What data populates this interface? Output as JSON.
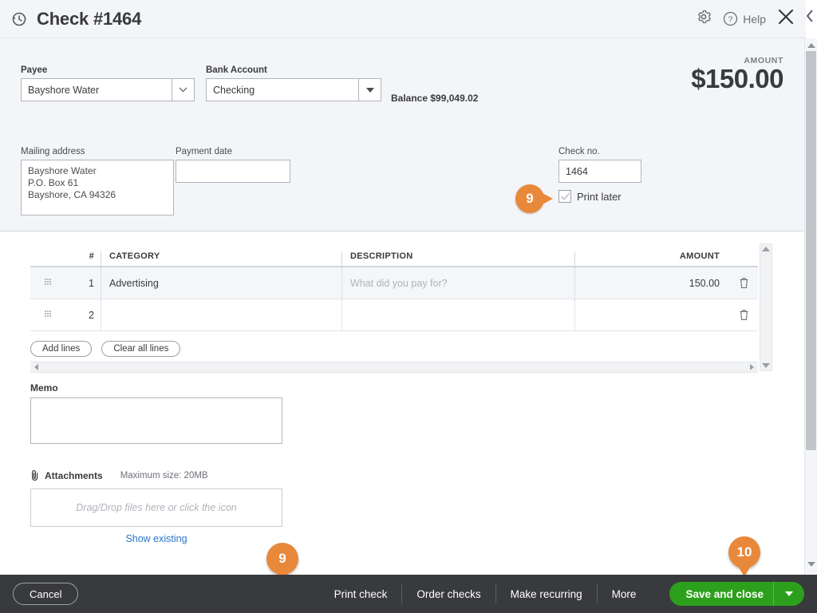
{
  "header": {
    "title": "Check #1464",
    "history_icon": "clock-history-icon",
    "gear_icon": "gear-icon",
    "help_icon": "question-circle-icon",
    "help_label": "Help",
    "close_icon": "close-icon"
  },
  "form": {
    "payee_label": "Payee",
    "payee_value": "Bayshore Water",
    "bank_label": "Bank Account",
    "bank_value": "Checking",
    "balance_text": "Balance $99,049.02",
    "amount_label": "AMOUNT",
    "amount_value": "$150.00",
    "mailing_label": "Mailing address",
    "mailing_line1": "Bayshore Water",
    "mailing_line2": "P.O. Box 61",
    "mailing_line3": "Bayshore, CA  94326",
    "payment_date_label": "Payment date",
    "payment_date_value": "",
    "check_no_label": "Check no.",
    "check_no_value": "1464",
    "print_later_label": "Print later",
    "print_later_checked": true
  },
  "callouts": [
    {
      "number": "9",
      "target": "print-later-checkbox"
    },
    {
      "number": "9",
      "target": "print-check-button"
    },
    {
      "number": "10",
      "target": "save-and-close-button"
    }
  ],
  "table": {
    "columns": [
      "#",
      "CATEGORY",
      "DESCRIPTION",
      "AMOUNT"
    ],
    "rows": [
      {
        "num": "1",
        "category": "Advertising",
        "description": "",
        "description_placeholder": "What did you pay for?",
        "amount": "150.00"
      },
      {
        "num": "2",
        "category": "",
        "description": "",
        "description_placeholder": "",
        "amount": ""
      }
    ],
    "add_lines_label": "Add lines",
    "clear_lines_label": "Clear all lines"
  },
  "memo": {
    "label": "Memo",
    "value": ""
  },
  "attachments": {
    "title": "Attachments",
    "max_size": "Maximum size: 20MB",
    "drop_placeholder": "Drag/Drop files here or click the icon",
    "show_existing_label": "Show existing",
    "link_color": "#2b76c6"
  },
  "footer": {
    "cancel_label": "Cancel",
    "links": [
      "Print check",
      "Order checks",
      "Make recurring",
      "More"
    ],
    "save_label": "Save and close",
    "save_color": "#2ca01c",
    "bar_color": "#393a3d"
  },
  "accent_color": "#e8883a"
}
